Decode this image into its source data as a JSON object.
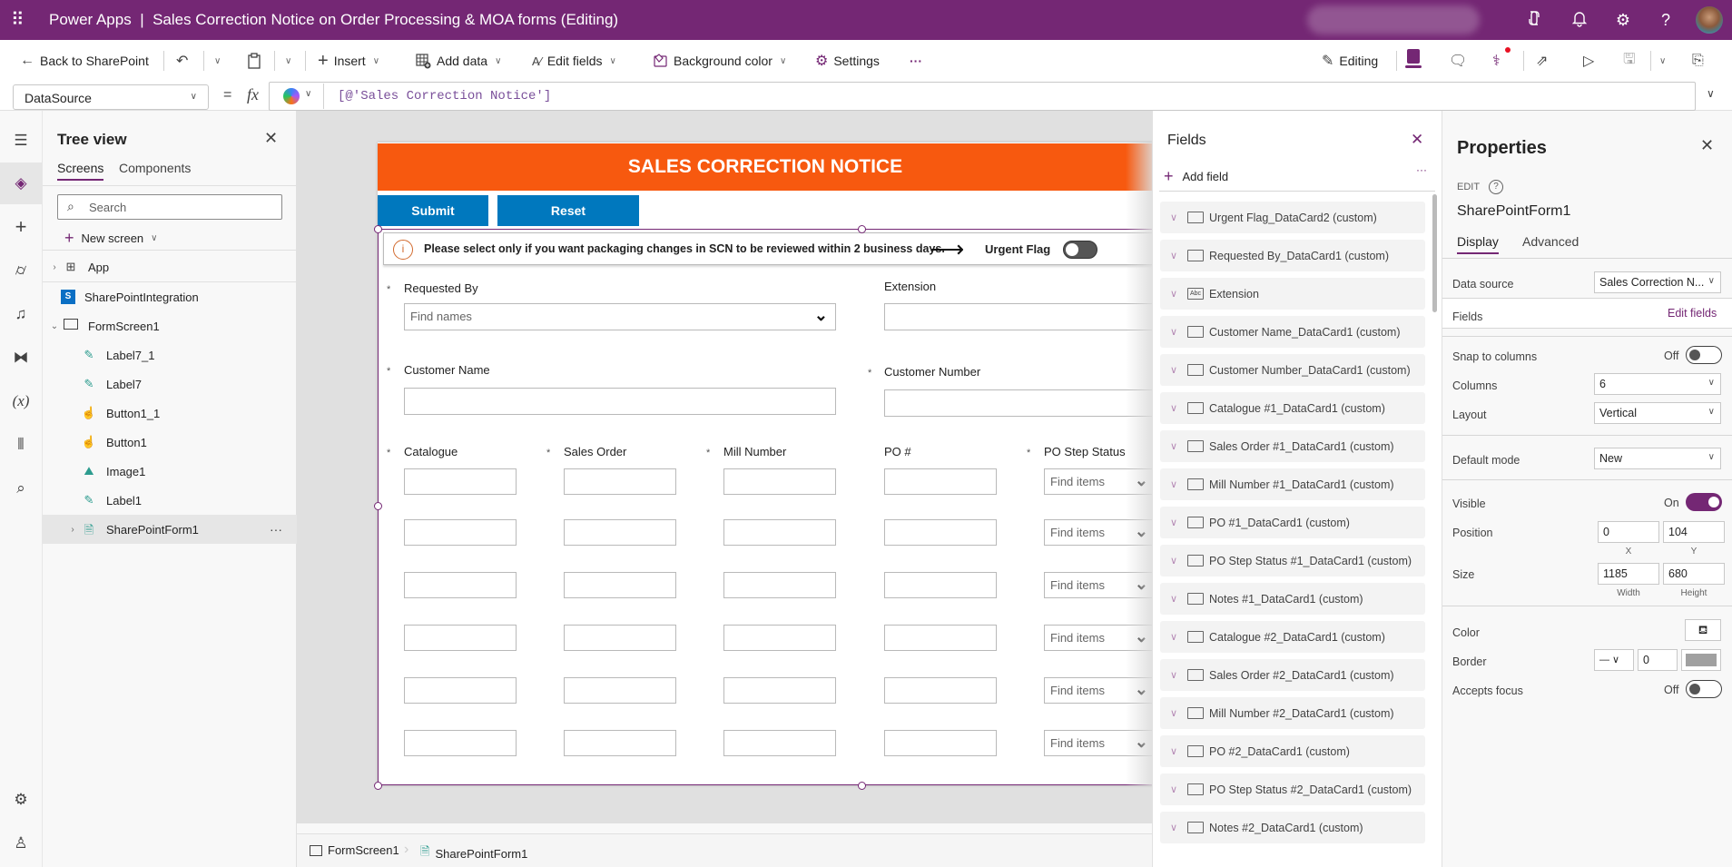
{
  "app": {
    "product": "Power Apps",
    "separator": "|",
    "title": "Sales Correction Notice on Order Processing & MOA forms (Editing)",
    "header_icons": [
      "copilot-icon",
      "bell-icon",
      "gear-icon",
      "help-icon",
      "avatar"
    ]
  },
  "toolbar": {
    "back": "Back to SharePoint",
    "insert": "Insert",
    "add_data": "Add data",
    "edit_fields": "Edit fields",
    "background_color": "Background color",
    "settings": "Settings",
    "more": "···",
    "editing": "Editing"
  },
  "formula_bar": {
    "property": "DataSource",
    "equals": "=",
    "fx": "fx",
    "formula": "[@'Sales Correction Notice']"
  },
  "tree_view": {
    "title": "Tree view",
    "tabs": [
      {
        "label": "Screens",
        "active": true
      },
      {
        "label": "Components",
        "active": false
      }
    ],
    "search_placeholder": "Search",
    "new_screen": "New screen",
    "items": [
      {
        "label": "App",
        "type": "app",
        "expandable": true,
        "level": 0
      },
      {
        "label": "SharePointIntegration",
        "type": "sharepoint",
        "level": 0
      },
      {
        "label": "FormScreen1",
        "type": "screen",
        "expanded": true,
        "level": 0
      },
      {
        "label": "Label7_1",
        "type": "label",
        "level": 1
      },
      {
        "label": "Label7",
        "type": "label",
        "level": 1
      },
      {
        "label": "Button1_1",
        "type": "button",
        "level": 1
      },
      {
        "label": "Button1",
        "type": "button",
        "level": 1
      },
      {
        "label": "Image1",
        "type": "image",
        "level": 1
      },
      {
        "label": "Label1",
        "type": "label",
        "level": 1
      },
      {
        "label": "SharePointForm1",
        "type": "form",
        "level": 1,
        "selected": true,
        "expandable": true
      }
    ],
    "more": "···"
  },
  "form": {
    "banner": "SALES CORRECTION NOTICE",
    "banner_color": "#F7590F",
    "submit": "Submit",
    "reset": "Reset",
    "button_color": "#0078BE",
    "notice": "Please select only if you want packaging changes in SCN to be reviewed within 2 business days.",
    "arrow": "⟶",
    "urgent_flag": "Urgent Flag",
    "urgent_flag_on": false,
    "requested_by": {
      "label": "Requested By",
      "required": true,
      "placeholder": "Find names"
    },
    "extension": {
      "label": "Extension",
      "required": false
    },
    "customer_name": {
      "label": "Customer Name",
      "required": true
    },
    "customer_number": {
      "label": "Customer Number",
      "required": true
    },
    "columns": [
      {
        "label": "Catalogue",
        "required": true
      },
      {
        "label": "Sales Order",
        "required": true
      },
      {
        "label": "Mill Number",
        "required": true
      },
      {
        "label": "PO #",
        "required": false
      },
      {
        "label": "PO Step Status",
        "required": true
      }
    ],
    "combo_placeholder": "Find items",
    "row_count": 6
  },
  "breadcrumb": [
    {
      "label": "FormScreen1",
      "icon": "screen-icon"
    },
    {
      "label": "SharePointForm1",
      "icon": "form-icon"
    }
  ],
  "fields_panel": {
    "title": "Fields",
    "add_field": "Add field",
    "more": "···",
    "items": [
      {
        "label": "Urgent Flag_DataCard2 (custom)",
        "icon": "card"
      },
      {
        "label": "Requested By_DataCard1 (custom)",
        "icon": "card"
      },
      {
        "label": "Extension",
        "icon": "text"
      },
      {
        "label": "Customer Name_DataCard1 (custom)",
        "icon": "card"
      },
      {
        "label": "Customer Number_DataCard1 (custom)",
        "icon": "card"
      },
      {
        "label": "Catalogue #1_DataCard1 (custom)",
        "icon": "card"
      },
      {
        "label": "Sales Order #1_DataCard1 (custom)",
        "icon": "card"
      },
      {
        "label": "Mill Number #1_DataCard1 (custom)",
        "icon": "card"
      },
      {
        "label": "PO #1_DataCard1 (custom)",
        "icon": "card"
      },
      {
        "label": "PO Step Status #1_DataCard1 (custom)",
        "icon": "card"
      },
      {
        "label": "Notes #1_DataCard1 (custom)",
        "icon": "card"
      },
      {
        "label": "Catalogue #2_DataCard1 (custom)",
        "icon": "card"
      },
      {
        "label": "Sales Order #2_DataCard1 (custom)",
        "icon": "card"
      },
      {
        "label": "Mill Number #2_DataCard1 (custom)",
        "icon": "card"
      },
      {
        "label": "PO #2_DataCard1 (custom)",
        "icon": "card"
      },
      {
        "label": "PO Step Status #2_DataCard1 (custom)",
        "icon": "card"
      },
      {
        "label": "Notes #2_DataCard1 (custom)",
        "icon": "card"
      }
    ]
  },
  "properties": {
    "title": "Properties",
    "edit_label": "EDIT",
    "control_name": "SharePointForm1",
    "tabs": [
      {
        "label": "Display",
        "active": true
      },
      {
        "label": "Advanced",
        "active": false
      }
    ],
    "data_source_label": "Data source",
    "data_source_value": "Sales Correction N...",
    "fields_label": "Fields",
    "edit_fields_link": "Edit fields",
    "snap_label": "Snap to columns",
    "snap_state": "Off",
    "columns_label": "Columns",
    "columns_value": "6",
    "layout_label": "Layout",
    "layout_value": "Vertical",
    "default_mode_label": "Default mode",
    "default_mode_value": "New",
    "visible_label": "Visible",
    "visible_state": "On",
    "position_label": "Position",
    "position_x": "0",
    "position_y": "104",
    "x_label": "X",
    "y_label": "Y",
    "size_label": "Size",
    "width": "1185",
    "height": "680",
    "width_label": "Width",
    "height_label": "Height",
    "color_label": "Color",
    "border_label": "Border",
    "border_width": "0",
    "border_color": "#A0A0A0",
    "accepts_focus_label": "Accepts focus",
    "accepts_focus_state": "Off",
    "accent_color": "#742774"
  }
}
